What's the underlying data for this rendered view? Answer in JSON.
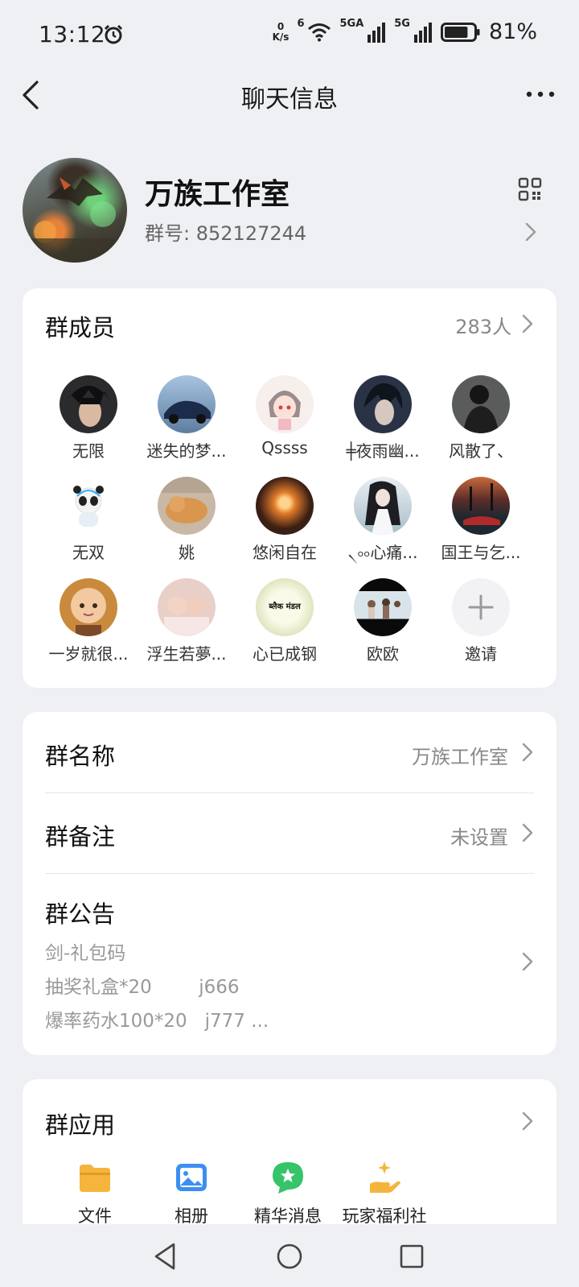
{
  "status_bar": {
    "time": "13:12",
    "net_speed_value": "0",
    "net_speed_unit": "K/s",
    "wifi_badge": "6",
    "signal1_label": "5GA",
    "signal2_label": "5G",
    "battery_level": 0.81,
    "battery_text": "81%"
  },
  "header": {
    "title": "聊天信息"
  },
  "group": {
    "name": "万族工作室",
    "id_label": "群号:",
    "id_value": "852127244"
  },
  "members": {
    "title": "群成员",
    "count": "283人",
    "items": [
      {
        "name": "无限",
        "color": "#2b2b2e"
      },
      {
        "name": "迷失的梦...",
        "color": "#5d7ea0"
      },
      {
        "name": "Qssss",
        "color": "#efd6d2"
      },
      {
        "name": "╪夜雨幽...",
        "color": "#2a3345"
      },
      {
        "name": "风散了、",
        "color": "#3d3f3e"
      },
      {
        "name": "无双",
        "color": "#ffffff"
      },
      {
        "name": "姚",
        "color": "#c9b8a6"
      },
      {
        "name": "悠闲自在",
        "color": "#3b1f14"
      },
      {
        "name": "৲৹৹心痛...",
        "color": "#c7d4dd"
      },
      {
        "name": "国王与乞...",
        "color": "#24313a"
      },
      {
        "name": "一岁就很...",
        "color": "#c98a3e"
      },
      {
        "name": "浮生若夢...",
        "color": "#e8cfc8"
      },
      {
        "name": "心已成钢",
        "color": "#f2f0d6"
      },
      {
        "name": "欧欧",
        "color": "#5a4a44"
      }
    ],
    "badge_text": "ब्लैक मंडल",
    "invite_label": "邀请"
  },
  "settings": {
    "group_name_label": "群名称",
    "group_name_value": "万族工作室",
    "remark_label": "群备注",
    "remark_value": "未设置",
    "notice_label": "群公告",
    "notice_lines": [
      "剑-礼包码",
      "抽奖礼盒*20        j666",
      "爆率药水100*20   j777 ..."
    ]
  },
  "apps": {
    "title": "群应用",
    "items": [
      {
        "label": "文件",
        "icon": "folder-icon",
        "color": "#f5b43c"
      },
      {
        "label": "相册",
        "icon": "photo-album-icon",
        "color": "#3c8ff0"
      },
      {
        "label": "精华消息",
        "icon": "featured-message-icon",
        "color": "#36c46a"
      },
      {
        "label": "玩家福利社",
        "icon": "player-welfare-icon",
        "color": "#f5b43c"
      }
    ]
  }
}
